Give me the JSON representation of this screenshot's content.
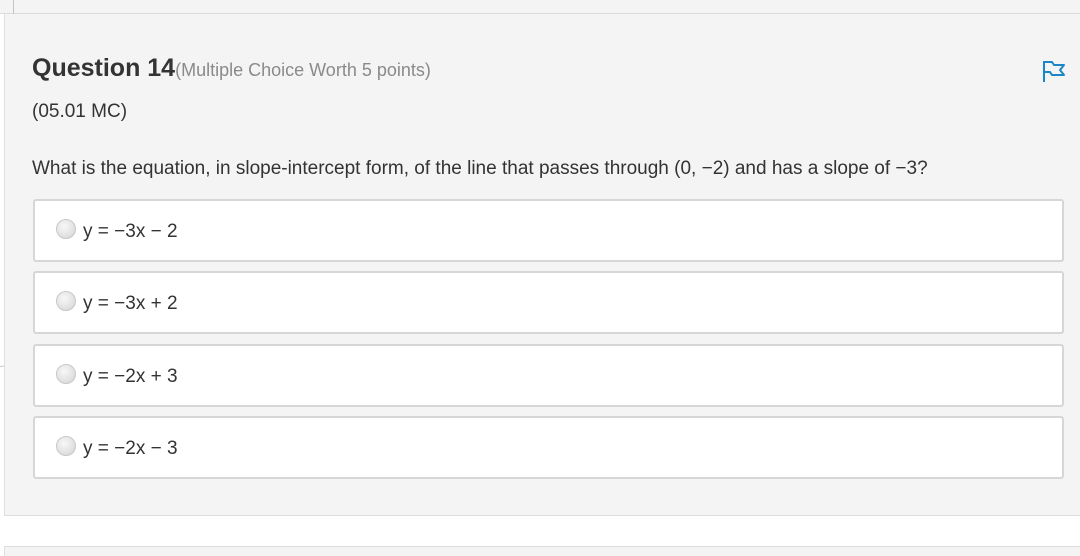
{
  "question": {
    "title": "Question 14",
    "meta": "(Multiple Choice Worth 5 points)",
    "code": "(05.01 MC)",
    "text": "What is the equation, in slope-intercept form, of the line that passes through (0, −2) and has a slope of −3?",
    "flag_icon": "flag-icon",
    "accent_color": "#1a86c7"
  },
  "options": [
    {
      "label": "y = −3x − 2",
      "selected": false
    },
    {
      "label": "y = −3x + 2",
      "selected": false
    },
    {
      "label": "y = −2x + 3",
      "selected": false
    },
    {
      "label": "y = −2x − 3",
      "selected": false
    }
  ]
}
